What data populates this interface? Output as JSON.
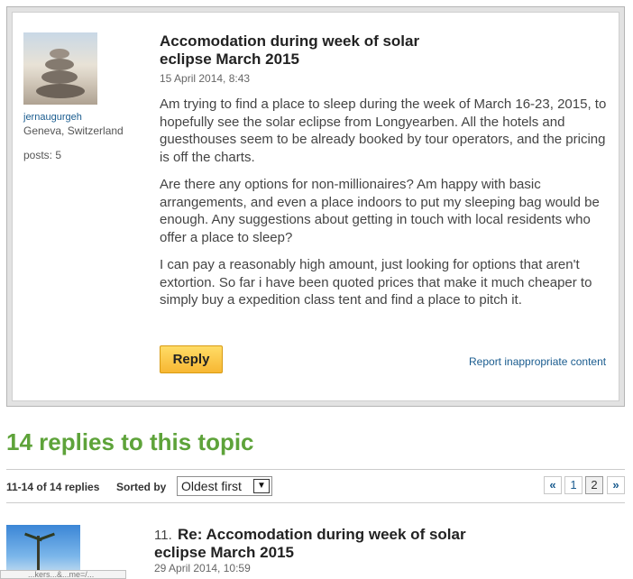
{
  "post": {
    "author": {
      "username": "jernaugurgeh",
      "location": "Geneva, Switzerland",
      "posts": "posts: 5"
    },
    "title": "Accomodation during week of solar eclipse March 2015",
    "date": "15 April 2014, 8:43",
    "paragraphs": [
      "Am trying to find a place to sleep during the week of March 16-23, 2015, to hopefully see the solar eclipse from Longyearben. All the hotels and guesthouses seem to be already booked by tour operators, and the pricing is off the charts.",
      "Are there any options for non-millionaires? Am happy with basic arrangements, and even a place indoors to put my sleeping bag would be enough. Any suggestions about getting in touch with local residents who offer a place to sleep?",
      "I can pay a reasonably high amount, just looking for options that aren't extortion. So far i have been quoted prices that make it much cheaper to simply buy a expedition class tent and find a place to pitch it."
    ],
    "reply_label": "Reply",
    "report_label": "Report inappropriate content"
  },
  "replies_section": {
    "heading": "14 replies to this topic",
    "range": "11-14 of 14 replies",
    "sorted_by_label": "Sorted by",
    "sort_value": "Oldest first",
    "pager": {
      "prev": "«",
      "pages": [
        "1",
        "2"
      ],
      "current_page": "2",
      "next": "»"
    }
  },
  "first_reply": {
    "number": "11.",
    "title": "Re: Accomodation during week of solar eclipse March 2015",
    "date": "29 April 2014, 10:59"
  },
  "status_bar": {
    "text": "...kers...&...me=/..."
  }
}
